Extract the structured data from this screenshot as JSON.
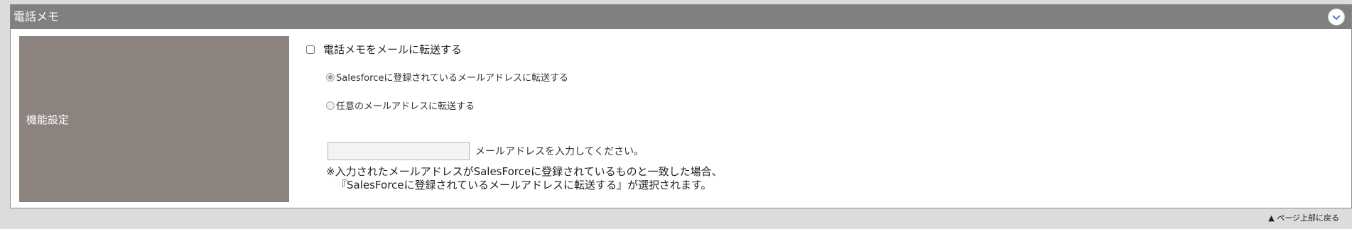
{
  "section": {
    "title": "電話メモ",
    "collapse_icon": "chevron-down-icon"
  },
  "setting": {
    "label": "機能設定",
    "forward_checkbox": {
      "label": "電話メモをメールに転送する",
      "checked": false
    },
    "radio_options": [
      {
        "label": "Salesforceに登録されているメールアドレスに転送する",
        "selected": true
      },
      {
        "label": "任意のメールアドレスに転送する",
        "selected": false
      }
    ],
    "email_input": {
      "value": "",
      "hint": "メールアドレスを入力してください。"
    },
    "note_lines": [
      "※入力されたメールアドレスがSalesForceに登録されているものと一致した場合、",
      "『SalesForceに登録されているメールアドレスに転送する』が選択されます。"
    ]
  },
  "footer": {
    "back_to_top": "▲ ページ上部に戻る"
  },
  "colors": {
    "page_bg": "#dcdcdc",
    "header_bg": "#808080",
    "label_bg": "#8c837e"
  }
}
